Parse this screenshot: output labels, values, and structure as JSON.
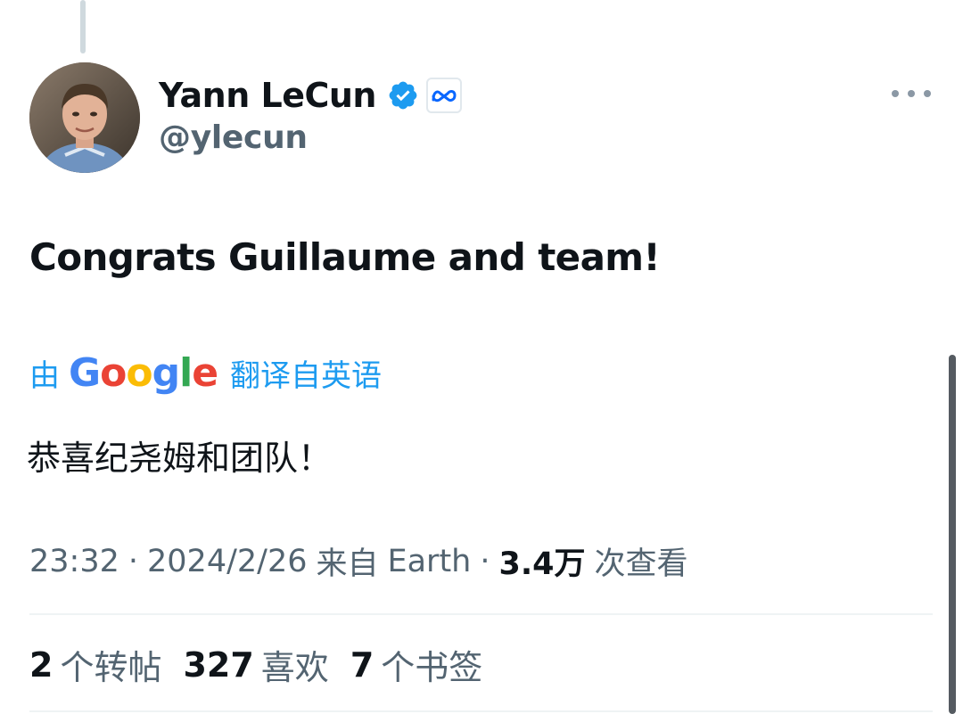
{
  "author": {
    "display_name": "Yann LeCun",
    "handle": "@ylecun",
    "verified_icon": "verified-badge-icon",
    "affiliation_icon": "meta-logo-icon"
  },
  "tweet": {
    "text": "Congrats Guillaume and team!"
  },
  "translation": {
    "prefix": "由",
    "provider": "Google",
    "suffix": "翻译自英语",
    "text": "恭喜纪尧姆和团队！"
  },
  "meta": {
    "time": "23:32",
    "date": "2024/2/26",
    "source_prefix": "来自",
    "source": "Earth",
    "views_count": "3.4万",
    "views_label": "次查看"
  },
  "stats": {
    "reposts": {
      "count": "2",
      "label": "个转帖"
    },
    "likes": {
      "count": "327",
      "label": "喜欢"
    },
    "bookmarks": {
      "count": "7",
      "label": "个书签"
    }
  },
  "colors": {
    "accent": "#1d9bf0",
    "text_primary": "#0f1419",
    "text_secondary": "#536471"
  }
}
